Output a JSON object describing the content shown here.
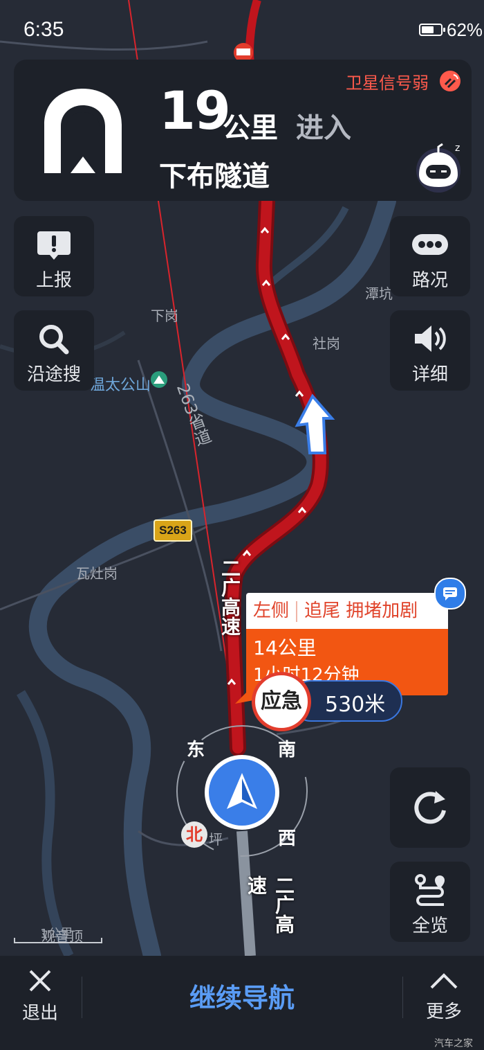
{
  "status": {
    "time": "6:35",
    "battery": "62%"
  },
  "guide": {
    "distance_value": "19",
    "distance_unit": "公里",
    "action": "进入",
    "road_name": "下布隧道",
    "gps_warning": "卫星信号弱",
    "maneuver_icon": "tunnel-icon"
  },
  "buttons": {
    "report": "上报",
    "search_along": "沿途搜",
    "traffic": "路况",
    "detail": "详细",
    "overview": "全览"
  },
  "map_labels": {
    "xiagang": "下岗",
    "tankeng": "潭坑",
    "shegang": "社岗",
    "wenta": "温太公山",
    "road_263": "263省道",
    "shield": "S263",
    "wazao": "瓦灶岗",
    "ping": "坪",
    "highway_top": "二广高速",
    "highway_bottom": "二广高速",
    "guanyinding": "观音顶"
  },
  "incident": {
    "side": "左侧",
    "type": "追尾 拥堵加剧",
    "distance": "14公里",
    "duration": "1小时12分钟"
  },
  "emergency": {
    "label": "应急",
    "distance": "530米"
  },
  "compass": {
    "east": "东",
    "south": "南",
    "west": "西",
    "north": "北"
  },
  "scale": "1公里",
  "bottom": {
    "exit": "退出",
    "continue": "继续导航",
    "more": "更多"
  },
  "watermark": "汽车之家",
  "colors": {
    "route": "#b0141c",
    "accent": "#3a7ee8",
    "warning": "#ff5a4c",
    "incident": "#f25612"
  }
}
